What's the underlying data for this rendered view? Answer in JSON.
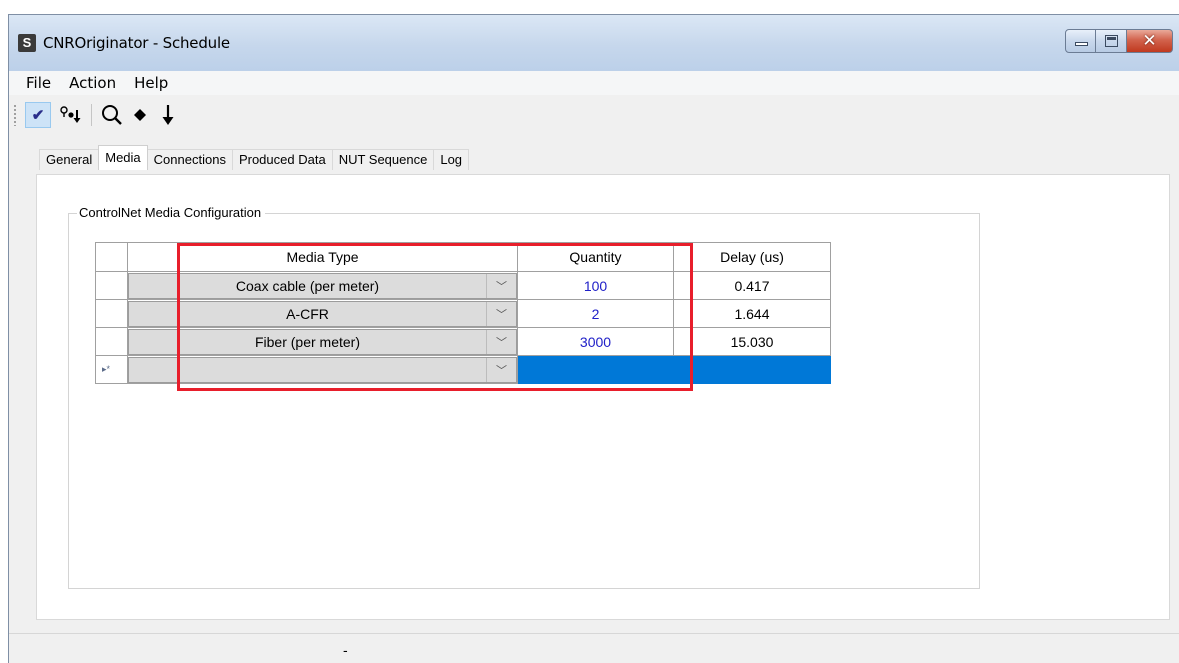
{
  "window": {
    "title": "CNROriginator - Schedule",
    "app_icon_glyph": "S"
  },
  "menubar": {
    "items": [
      "File",
      "Action",
      "Help"
    ]
  },
  "toolbar": {
    "buttons": [
      {
        "icon": "checkmark-icon",
        "glyph": "✔",
        "pressed": true
      },
      {
        "icon": "connection-flow-icon",
        "glyph": "⚲"
      },
      {
        "icon": "search-icon",
        "glyph": "🔍"
      },
      {
        "icon": "diamond-icon",
        "glyph": "◆"
      },
      {
        "icon": "down-arrow-icon",
        "glyph": "↓"
      }
    ]
  },
  "tabs": [
    "General",
    "Media",
    "Connections",
    "Produced Data",
    "NUT Sequence",
    "Log"
  ],
  "active_tab": "Media",
  "media": {
    "group_title": "ControlNet Media Configuration",
    "columns": [
      "Media Type",
      "Quantity",
      "Delay (us)"
    ],
    "rows": [
      {
        "media_type": "Coax cable (per meter)",
        "quantity": "100",
        "delay": "0.417"
      },
      {
        "media_type": "A-CFR",
        "quantity": "2",
        "delay": "1.644"
      },
      {
        "media_type": "Fiber (per meter)",
        "quantity": "3000",
        "delay": "15.030"
      }
    ],
    "new_row_marker": "▸*",
    "dropdown_glyph": "﹀"
  },
  "statusbar": {
    "text": "-"
  },
  "colors": {
    "selection": "#0078d7",
    "annotation": "#e81e2b",
    "quantity_text": "#2020c8"
  }
}
